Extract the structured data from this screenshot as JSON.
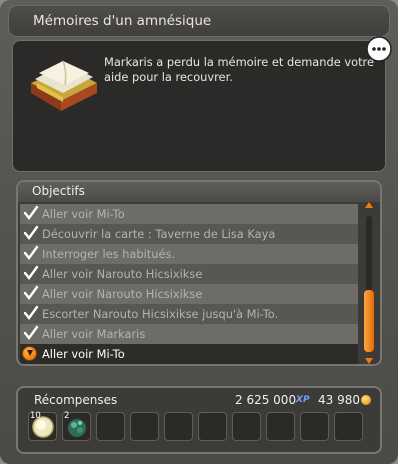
{
  "window": {
    "title": "Mémoires d'un amnésique"
  },
  "description": "Markaris a perdu la mémoire et demande votre aide pour la recouvrer.",
  "objectives": {
    "header": "Objectifs",
    "items": [
      {
        "label": "Aller voir Mi-To",
        "status": "done"
      },
      {
        "label": "Découvrir la carte : Taverne de Lisa Kaya",
        "status": "done"
      },
      {
        "label": "Interroger les habitués.",
        "status": "done"
      },
      {
        "label": "Aller voir Narouto Hicsixikse",
        "status": "done"
      },
      {
        "label": "Aller voir Narouto Hicsixikse",
        "status": "done"
      },
      {
        "label": "Escorter Narouto Hicsixikse jusqu'à Mi-To.",
        "status": "done"
      },
      {
        "label": "Aller voir Markaris",
        "status": "done"
      },
      {
        "label": "Aller voir Mi-To",
        "status": "current"
      }
    ]
  },
  "rewards": {
    "title": "Récompenses",
    "xp": "2 625 000",
    "xp_icon": "XP",
    "kamas": "43 980",
    "items": [
      {
        "icon": "orb-icon",
        "quantity": "10"
      },
      {
        "icon": "green-resource-icon",
        "quantity": "2"
      }
    ],
    "empty_slots": 8
  },
  "colors": {
    "accent": "#f07c10",
    "check": "#ffffff",
    "done_text": "#b5b3ad"
  }
}
